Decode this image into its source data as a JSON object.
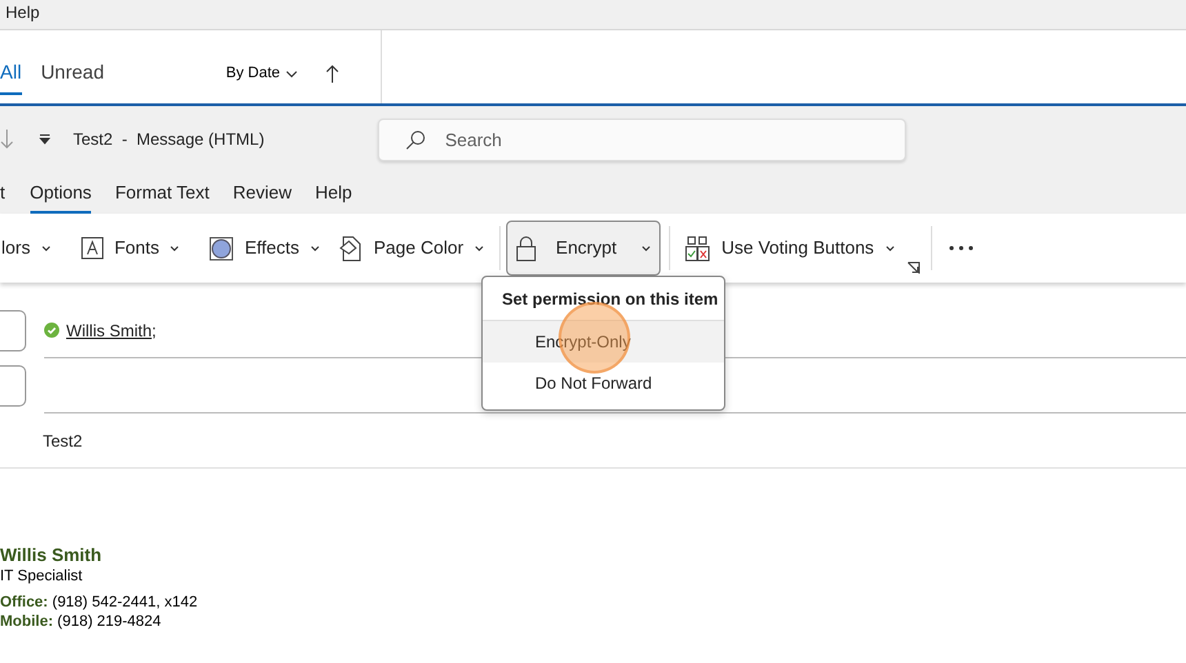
{
  "menu_bar": {
    "items": [
      "Help"
    ]
  },
  "mail_list": {
    "filters": [
      {
        "label": "All",
        "selected": true
      },
      {
        "label": "Unread",
        "selected": false
      }
    ],
    "sort": "By Date"
  },
  "compose": {
    "title": "Test2  -  Message (HTML)",
    "search": {
      "placeholder": "Search"
    },
    "ribbon_tabs": [
      {
        "label": "t",
        "selected": false
      },
      {
        "label": "Options",
        "selected": true
      },
      {
        "label": "Format Text",
        "selected": false
      },
      {
        "label": "Review",
        "selected": false
      },
      {
        "label": "Help",
        "selected": false
      }
    ],
    "toolbar": [
      {
        "kind": "dropdown",
        "label": "lors"
      },
      {
        "kind": "dropdown",
        "label": "Fonts"
      },
      {
        "kind": "dropdown",
        "label": "Effects"
      },
      {
        "kind": "dropdown",
        "label": "Page Color"
      },
      {
        "kind": "split",
        "label": "Encrypt",
        "expanded": true
      },
      {
        "kind": "dropdown",
        "label": "Use Voting Buttons"
      }
    ],
    "encrypt_menu": {
      "header": "Set permission on this item",
      "items": [
        {
          "label": "Encrypt-Only",
          "selected": true
        },
        {
          "label": "Do Not Forward",
          "selected": false
        }
      ]
    },
    "recipients": [
      {
        "name": "Willis Smith;",
        "verified": true
      }
    ],
    "subject": "Test2",
    "signature": {
      "name": "Willis Smith",
      "title": "IT Specialist",
      "lines": [
        {
          "label": "Office:",
          "value": "(918) 542-2441, x142"
        },
        {
          "label": "Mobile:",
          "value": "(918) 219-4824"
        }
      ]
    }
  }
}
